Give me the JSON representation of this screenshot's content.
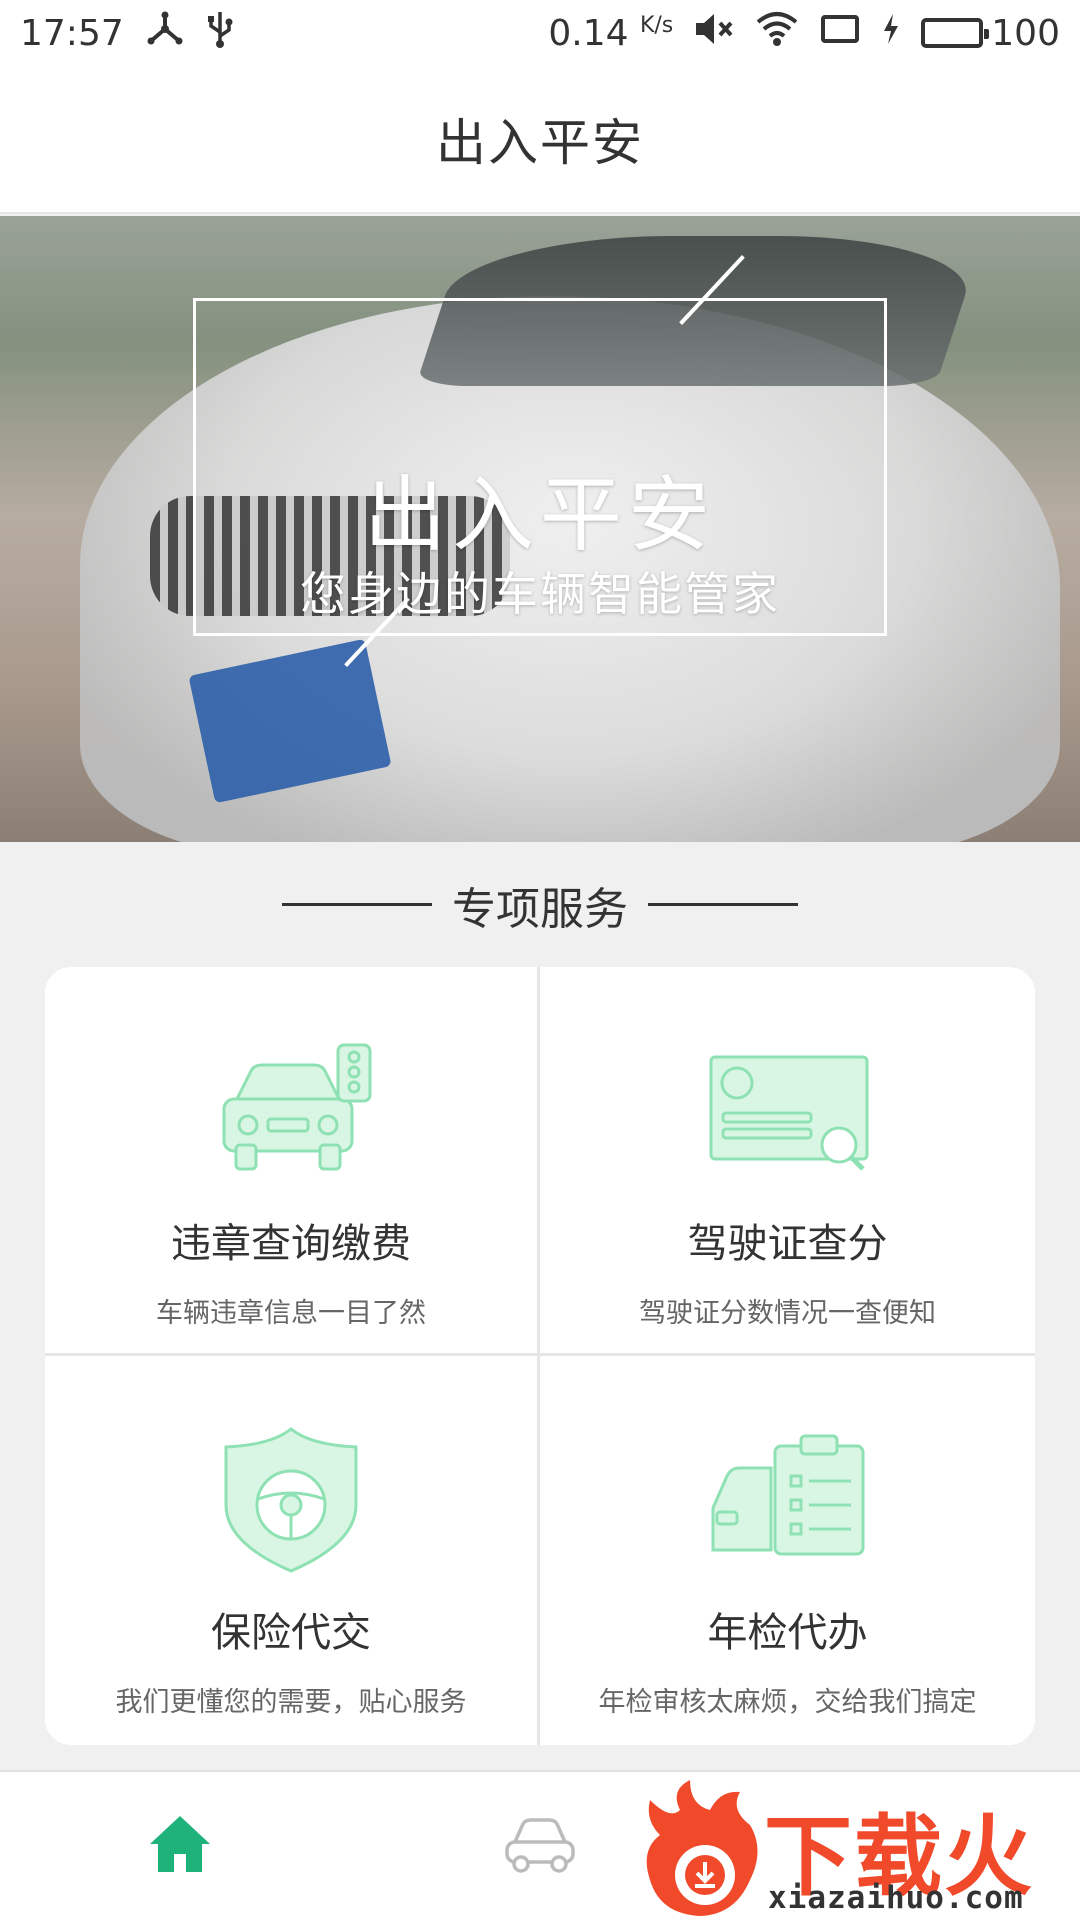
{
  "status_bar": {
    "time": "17:57",
    "speed_value": "0.14",
    "speed_unit": "K/s",
    "battery_level": "100",
    "battery_fraction": 1.0,
    "icons": [
      "usb-tether-icon",
      "usb-icon",
      "mute-icon",
      "wifi-icon",
      "screen-icon",
      "charging-icon",
      "battery-icon"
    ]
  },
  "header": {
    "title": "出入平安"
  },
  "banner": {
    "title": "出入平安",
    "subtitle": "您身边的车辆智能管家"
  },
  "section": {
    "title": "专项服务"
  },
  "services": [
    {
      "name": "违章查询缴费",
      "desc": "车辆违章信息一目了然",
      "icon": "car-traffic-light-icon"
    },
    {
      "name": "驾驶证查分",
      "desc": "驾驶证分数情况一查便知",
      "icon": "license-search-icon"
    },
    {
      "name": "保险代交",
      "desc": "我们更懂您的需要，贴心服务",
      "icon": "shield-steering-wheel-icon"
    },
    {
      "name": "年检代办",
      "desc": "年检审核太麻烦，交给我们搞定",
      "icon": "car-checklist-icon"
    }
  ],
  "bottom_nav": {
    "items": [
      {
        "icon": "home-icon",
        "active": true
      },
      {
        "icon": "car-icon",
        "active": false
      }
    ]
  },
  "watermark": {
    "text": "下载火",
    "url": "xiazaihuo.com"
  },
  "colors": {
    "accent": "#1fb27a",
    "icon_fill": "#d9f6e4",
    "icon_stroke": "#8ee1b3",
    "watermark": "#f04a2b"
  }
}
